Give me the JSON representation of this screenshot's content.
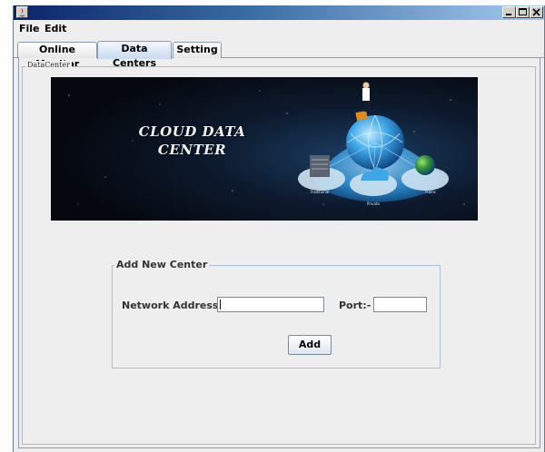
{
  "window": {
    "menu": [
      {
        "label": "File"
      },
      {
        "label": "Edit"
      }
    ],
    "controls": {
      "minimize": "minimize-icon",
      "maximize": "maximize-icon",
      "close": "close-icon"
    }
  },
  "tabs": [
    {
      "label": "Online Monitor",
      "active": false
    },
    {
      "label": "Data Centers",
      "active": true
    },
    {
      "label": "Setting",
      "active": false
    }
  ],
  "panel": {
    "group_title": "DataCenter",
    "banner": {
      "line1": "CLOUD DATA",
      "line2": "CENTER",
      "node_labels": [
        "Traditional",
        "Private",
        "Public"
      ]
    },
    "form": {
      "title": "Add New Center",
      "network_label": "Network Address:-",
      "network_value": "",
      "port_label": "Port:-",
      "port_value": "",
      "add_label": "Add"
    }
  },
  "colors": {
    "window_bg": "#eeeeee",
    "active_tab": "#c9daf0",
    "title_bar": "#0a246a"
  }
}
